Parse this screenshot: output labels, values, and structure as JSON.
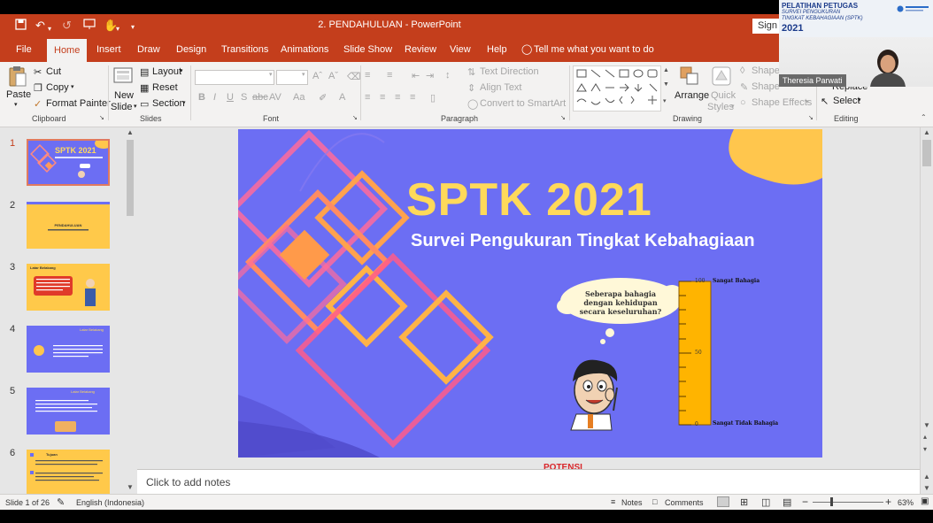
{
  "window": {
    "title": "2. PENDAHULUAN  -  PowerPoint",
    "sign_in": "Sign"
  },
  "tabs": [
    "File",
    "Home",
    "Insert",
    "Draw",
    "Design",
    "Transitions",
    "Animations",
    "Slide Show",
    "Review",
    "View",
    "Help"
  ],
  "tell_me": "Tell me what you want to do",
  "ribbon": {
    "clipboard": {
      "paste": "Paste",
      "cut": "Cut",
      "copy": "Copy",
      "format_painter": "Format Painter",
      "group": "Clipboard"
    },
    "slides": {
      "new_slide_1": "New",
      "new_slide_2": "Slide",
      "layout": "Layout",
      "reset": "Reset",
      "section": "Section",
      "group": "Slides"
    },
    "font": {
      "group": "Font",
      "bold": "B",
      "italic": "I",
      "underline": "U",
      "strike": "S",
      "abc": "abc",
      "av": "AV",
      "aa": "Aa",
      "a": "A"
    },
    "paragraph": {
      "text_direction": "Text Direction",
      "align_text": "Align Text",
      "convert": "Convert to SmartArt",
      "group": "Paragraph"
    },
    "drawing": {
      "arrange": "Arrange",
      "quick_1": "Quick",
      "quick_2": "Styles",
      "shape_fill": "Shape",
      "shape_outline": "Shape",
      "shape_effects": "Shape Effects",
      "group": "Drawing"
    },
    "editing": {
      "replace": "Replace",
      "select": "Select",
      "group": "Editing"
    }
  },
  "webcam": {
    "line1": "PELATIHAN PETUGAS",
    "line2": "SURVEI PENGUKURAN",
    "line3": "TINGKAT KEBAHAGIAAN (SPTK)",
    "line4": "2021",
    "name": "Theresia Parwati"
  },
  "thumbnails": [
    {
      "num": "1",
      "title": "SPTK 2021"
    },
    {
      "num": "2",
      "title": "PENDAHULUAN"
    },
    {
      "num": "3",
      "title": "Latar Belakang"
    },
    {
      "num": "4",
      "title": "Latar Belakang"
    },
    {
      "num": "5",
      "title": "Latar Belakang"
    },
    {
      "num": "6",
      "title": "Tujuan"
    }
  ],
  "slide": {
    "title": "SPTK 2021",
    "subtitle": "Survei Pengukuran Tingkat Kebahagiaan",
    "bubble": "Seberapa bahagia dengan kehidupan secara keseluruhan?",
    "scale_top_value": "100",
    "scale_mid_value": "50",
    "scale_bottom_value": "0",
    "scale_top_label": "Sangat Bahagia",
    "scale_bottom_label": "Sangat Tidak Bahagia",
    "below_text": "POTENSI"
  },
  "notes": "Click to add notes",
  "status": {
    "slide": "Slide 1 of 26",
    "language": "English (Indonesia)",
    "notes": "Notes",
    "comments": "Comments",
    "zoom": "63%"
  },
  "colors": {
    "accent": "#c43e1c",
    "slide_bg": "#6c6ef3",
    "title_yellow": "#ffd95a",
    "scale_orange": "#ffb400"
  }
}
